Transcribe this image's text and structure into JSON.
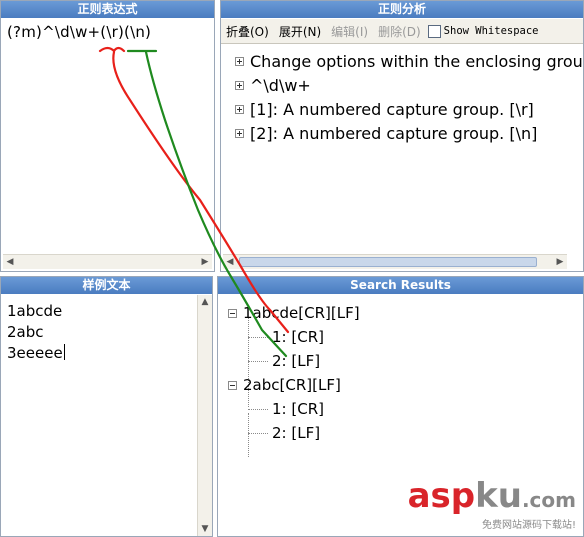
{
  "regex_panel": {
    "title": "正则表达式",
    "pattern": "(?m)^\\d\\w+(\\r)(\\n)"
  },
  "analysis_panel": {
    "title": "正则分析",
    "toolbar": {
      "collapse": "折叠(O)",
      "expand": "展开(N)",
      "edit": "编辑(I)",
      "delete": "删除(D)",
      "show_whitespace": "Show Whitespace"
    },
    "nodes": [
      "Change options within the enclosing group",
      "^\\d\\w+",
      "[1]: A numbered capture group. [\\r]",
      "[2]: A numbered capture group. [\\n]"
    ]
  },
  "sample_panel": {
    "title": "样例文本",
    "lines": [
      "1abcde",
      "2abc",
      "3eeeee"
    ]
  },
  "results_panel": {
    "title": "Search Results",
    "matches": [
      {
        "label": "1abcde[CR][LF]",
        "groups": [
          "1: [CR]",
          "2: [LF]"
        ]
      },
      {
        "label": "2abc[CR][LF]",
        "groups": [
          "1: [CR]",
          "2: [LF]"
        ]
      }
    ]
  },
  "annotations": {
    "red_color": "#e8201a",
    "green_color": "#1f8a1f"
  },
  "watermark": {
    "brand_a": "asp",
    "brand_b": "ku",
    "suffix": ".com",
    "tagline": "免费网站源码下载站!"
  }
}
